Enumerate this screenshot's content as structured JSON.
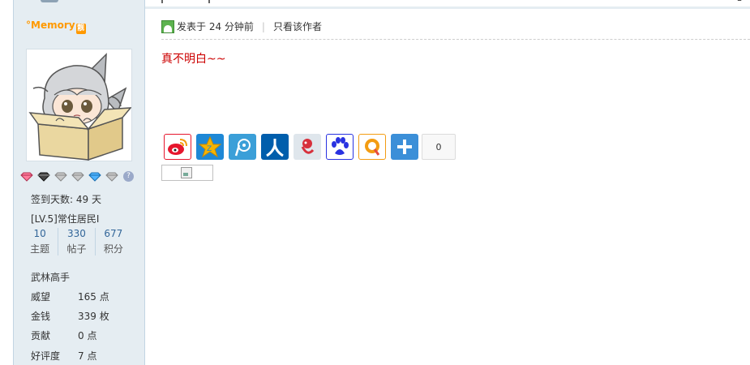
{
  "user": {
    "name": "°Memory",
    "badge": "靓",
    "checkin": "签到天数: 49 天",
    "level": "[LV.5]常住居民I",
    "counts": [
      {
        "num": "10",
        "label": "主题"
      },
      {
        "num": "330",
        "label": "帖子"
      },
      {
        "num": "677",
        "label": "积分"
      }
    ],
    "rank_title": "武林高手",
    "details": [
      {
        "label": "威望",
        "value": "165 点"
      },
      {
        "label": "金钱",
        "value": "339 枚"
      },
      {
        "label": "贡献",
        "value": "0 点"
      },
      {
        "label": "好评度",
        "value": "7 点"
      }
    ],
    "medal_help": "?"
  },
  "post": {
    "posted_time": "发表于 24 分钟前",
    "separator": "|",
    "only_author": "只看该作者",
    "content": "真不明白~~"
  },
  "share": {
    "count": "0",
    "buttons": [
      {
        "name": "sina-weibo-icon",
        "color": "#e6162d"
      },
      {
        "name": "qzone-icon",
        "color": "#f5b400"
      },
      {
        "name": "tencent-weibo-icon",
        "color": "#3b9fd8"
      },
      {
        "name": "renren-icon",
        "color": "#005eac"
      },
      {
        "name": "kaixin-icon",
        "color": "#d7303c"
      },
      {
        "name": "baidu-icon",
        "color": "#2932e1"
      },
      {
        "name": "qq-friend-icon",
        "color": "#f39c12"
      },
      {
        "name": "more-share-icon",
        "color": "#3b8fd8"
      }
    ]
  },
  "colors": {
    "sidebar_bg": "#e5edf2",
    "username": "#ff9900",
    "link_blue": "#336699",
    "post_text": "#cc0000"
  }
}
